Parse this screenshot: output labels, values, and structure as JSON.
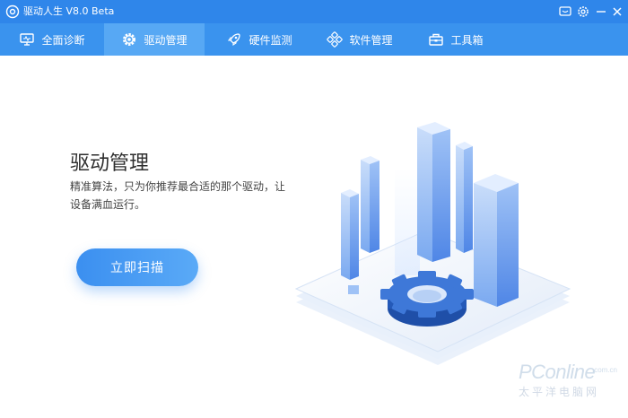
{
  "app": {
    "title": "驱动人生 V8.0 Beta"
  },
  "nav": {
    "tabs": [
      {
        "label": "全面诊断",
        "icon": "monitor-icon"
      },
      {
        "label": "驱动管理",
        "icon": "gear-icon",
        "active": true
      },
      {
        "label": "硬件监测",
        "icon": "rocket-icon"
      },
      {
        "label": "软件管理",
        "icon": "apps-icon"
      },
      {
        "label": "工具箱",
        "icon": "toolbox-icon"
      }
    ]
  },
  "main": {
    "title": "驱动管理",
    "description": "精准算法，只为你推荐最合适的那个驱动，让设备满血运行。",
    "scan_button": "立即扫描"
  },
  "watermark": {
    "main": "PConline",
    "sub": "太平洋电脑网",
    "domain": ".com.cn"
  },
  "colors": {
    "titlebar": "#2f86ea",
    "navbar": "#3a93ee",
    "active_tab": "#57a8f4",
    "button": "#3b8ff0"
  }
}
